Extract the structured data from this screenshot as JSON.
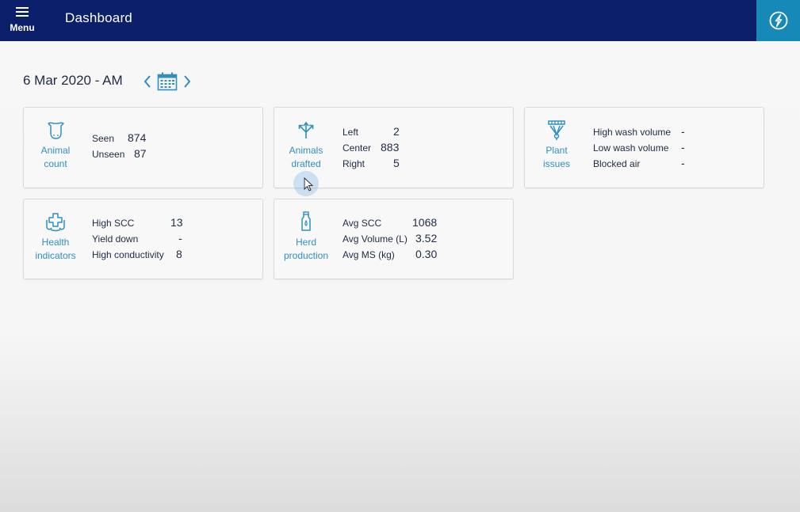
{
  "header": {
    "menu_label": "Menu",
    "title": "Dashboard",
    "bar_color": "#0b1f6b",
    "action_color": "#1789b9",
    "action_icon": "power-plug-icon"
  },
  "date_nav": {
    "date_label": "6 Mar 2020 - AM",
    "prev_icon": "chevron-left-icon",
    "calendar_icon": "calendar-icon",
    "next_icon": "chevron-right-icon"
  },
  "cards": {
    "animal_count": {
      "icon": "cow-head-icon",
      "label_line1": "Animal",
      "label_line2": "count",
      "rows": [
        {
          "label": "Seen",
          "value": "874"
        },
        {
          "label": "Unseen",
          "value": "87"
        }
      ]
    },
    "animals_drafted": {
      "icon": "drafting-arrows-icon",
      "label_line1": "Animals",
      "label_line2": "drafted",
      "rows": [
        {
          "label": "Left",
          "value": "2"
        },
        {
          "label": "Center",
          "value": "883"
        },
        {
          "label": "Right",
          "value": "5"
        }
      ]
    },
    "plant_issues": {
      "icon": "milking-plant-icon",
      "label_line1": "Plant",
      "label_line2": "issues",
      "rows": [
        {
          "label": "High wash volume",
          "value": "-"
        },
        {
          "label": "Low wash volume",
          "value": "-"
        },
        {
          "label": "Blocked air",
          "value": "-"
        }
      ]
    },
    "health_indicators": {
      "icon": "health-cross-icon",
      "label_line1": "Health",
      "label_line2": "indicators",
      "rows": [
        {
          "label": "High SCC",
          "value": "13"
        },
        {
          "label": "Yield down",
          "value": "-"
        },
        {
          "label": "High conductivity",
          "value": "8"
        }
      ]
    },
    "herd_production": {
      "icon": "milk-bottle-icon",
      "label_line1": "Herd",
      "label_line2": "production",
      "rows": [
        {
          "label": "Avg SCC",
          "value": "1068"
        },
        {
          "label": "Avg Volume (L)",
          "value": "3.52"
        },
        {
          "label": "Avg MS (kg)",
          "value": "0.30"
        }
      ]
    }
  },
  "accent_color": "#2f8fbf"
}
